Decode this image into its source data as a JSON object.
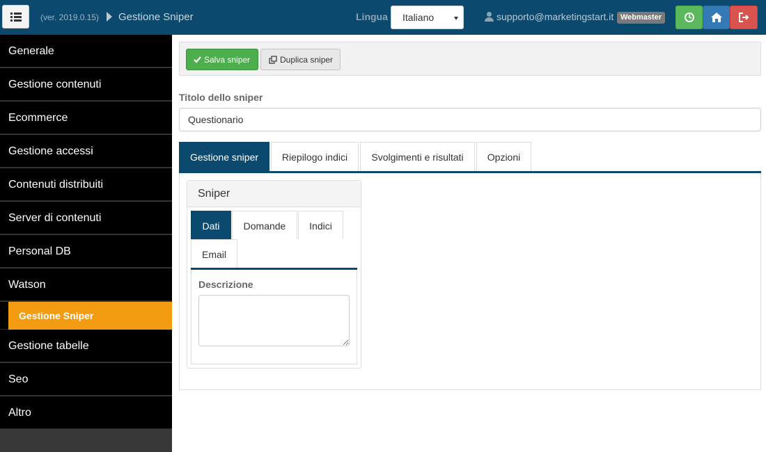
{
  "header": {
    "version": "(ver. 2019.0.15)",
    "page_title": "Gestione Sniper",
    "language_label": "Lingua",
    "language_selected": "Italiano",
    "user_email": "supporto@marketingstart.it",
    "user_role": "Webmaster",
    "icons": [
      "menu-icon",
      "clock-icon",
      "home-icon",
      "logout-icon"
    ]
  },
  "sidebar": {
    "items": [
      {
        "label": "Generale"
      },
      {
        "label": "Gestione contenuti"
      },
      {
        "label": "Ecommerce"
      },
      {
        "label": "Gestione accessi"
      },
      {
        "label": "Contenuti distribuiti"
      },
      {
        "label": "Server di contenuti"
      },
      {
        "label": "Personal DB"
      },
      {
        "label": "Watson"
      },
      {
        "label": "Gestione Sniper",
        "active": true
      },
      {
        "label": "Gestione tabelle"
      },
      {
        "label": "Seo"
      },
      {
        "label": "Altro"
      }
    ]
  },
  "toolbar": {
    "save_label": "Salva sniper",
    "duplicate_label": "Duplica sniper"
  },
  "form": {
    "title_label": "Titolo dello sniper",
    "title_value": "Questionario"
  },
  "tabs": [
    {
      "label": "Gestione sniper",
      "active": true
    },
    {
      "label": "Riepilogo indici"
    },
    {
      "label": "Svolgimenti e risultati"
    },
    {
      "label": "Opzioni"
    }
  ],
  "panel": {
    "title": "Sniper",
    "tabs": [
      {
        "label": "Dati",
        "active": true
      },
      {
        "label": "Domande"
      },
      {
        "label": "Indici"
      },
      {
        "label": "Email"
      }
    ],
    "description_label": "Descrizione",
    "description_value": ""
  },
  "colors": {
    "header_bg": "#0b4a6e",
    "active_sidebar": "#f39c12",
    "save_green": "#4cae4c",
    "logout_red": "#d9534f",
    "home_blue": "#337ab7"
  }
}
